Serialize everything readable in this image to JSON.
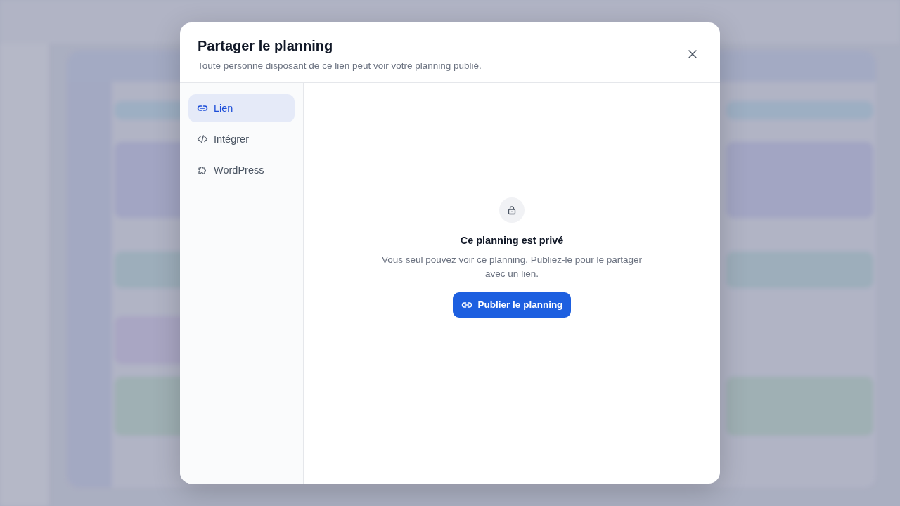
{
  "dialog": {
    "title": "Partager le planning",
    "subtitle": "Toute personne disposant de ce lien peut voir votre planning publié.",
    "tabs": [
      {
        "label": "Lien",
        "kind": "link",
        "selected": true
      },
      {
        "label": "Intégrer",
        "kind": "embed",
        "selected": false
      },
      {
        "label": "WordPress",
        "kind": "plugin",
        "selected": false
      }
    ],
    "empty_state": {
      "title": "Ce planning est privé",
      "text": "Vous seul pouvez voir ce planning. Publiez-le pour le partager avec un lien.",
      "button": "Publier le planning"
    }
  }
}
